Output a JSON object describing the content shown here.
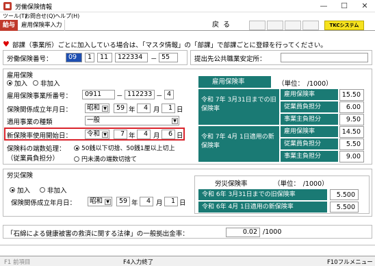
{
  "window": {
    "title": "労働保険情報",
    "minimize": "—",
    "maximize": "☐",
    "close": "✕"
  },
  "menu": [
    "ツール(T)",
    "お問合せ(Q)",
    "ヘルプ(H)"
  ],
  "toolbar": {
    "kyuyo": "給与",
    "tab": "雇用保険率入力",
    "back": "戻る",
    "tkc": "TKCシステムQ&A"
  },
  "notice": "部課（事業所）ごとに加入している場合は、「マスタ情報」の「部課」で部課ごとに登録を行ってください。",
  "labor_no": {
    "label": "労働保険番号：",
    "v1": "09",
    "v2": "1",
    "v3": "11",
    "v4": "122334",
    "sep": "－",
    "v5": "55"
  },
  "submit": {
    "label": "提出先公共職業安定所：",
    "value": ""
  },
  "employment": {
    "title": "雇用保険",
    "join": "加入",
    "not_join": "非加入",
    "office_no_label": "雇用保険事業所番号：",
    "office_no1": "0911",
    "office_no2": "112233",
    "office_no3": "4",
    "est_label": "保険関係成立年月日：",
    "est_era": "昭和",
    "est_year": "59",
    "est_month": "4",
    "est_day": "1",
    "business_label": "適用事業の種類",
    "business_value": "一般",
    "new_rate_label": "新保険率使用開始日：",
    "new_era": "令和",
    "new_year": "7",
    "new_month": "4",
    "new_day": "6",
    "rounding_label": "保険料の端数処理：",
    "rounding_sub": "（従業員負担分）",
    "rounding_opt1": "50銭以下切捨、50銭1厘以上切上",
    "rounding_opt2": "円未満の端数切捨て"
  },
  "units": {
    "year": "年",
    "month": "月",
    "day": "日",
    "dash": "－"
  },
  "emp_rate": {
    "title": "雇用保険率",
    "unit": "（単位：　/1000）",
    "old_label": "令和 7年 3月31日までの旧保険率",
    "new_label": "令和 7年 4月 1日適用の新保険率",
    "row_total": "雇用保険率",
    "row_emp": "従業員負担分",
    "row_er": "事業主負担分",
    "old_total": "15.50",
    "old_emp": "6.00",
    "old_er": "9.50",
    "new_total": "14.50",
    "new_emp": "5.50",
    "new_er": "9.00"
  },
  "accident": {
    "title": "労災保険",
    "join": "加入",
    "not_join": "非加入",
    "est_label": "保険関係成立年月日：",
    "est_era": "昭和",
    "est_year": "59",
    "est_month": "4",
    "est_day": "1"
  },
  "acc_rate": {
    "title": "労災保険率",
    "unit": "（単位：　/1000）",
    "old_label": "令和 6年 3月31日までの旧保険率",
    "new_label": "令和 6年 4月 1日適用の新保険率",
    "old": "5.500",
    "new": "5.500"
  },
  "asbestos": {
    "label": "「石綿による健康被害の救済に関する法律」の一般拠出金率：",
    "value": "0.02",
    "unit": "/1000"
  },
  "status": {
    "f1": "F1 前項目",
    "f4": "F4入力終了",
    "f10": "F10フルメニュー"
  }
}
